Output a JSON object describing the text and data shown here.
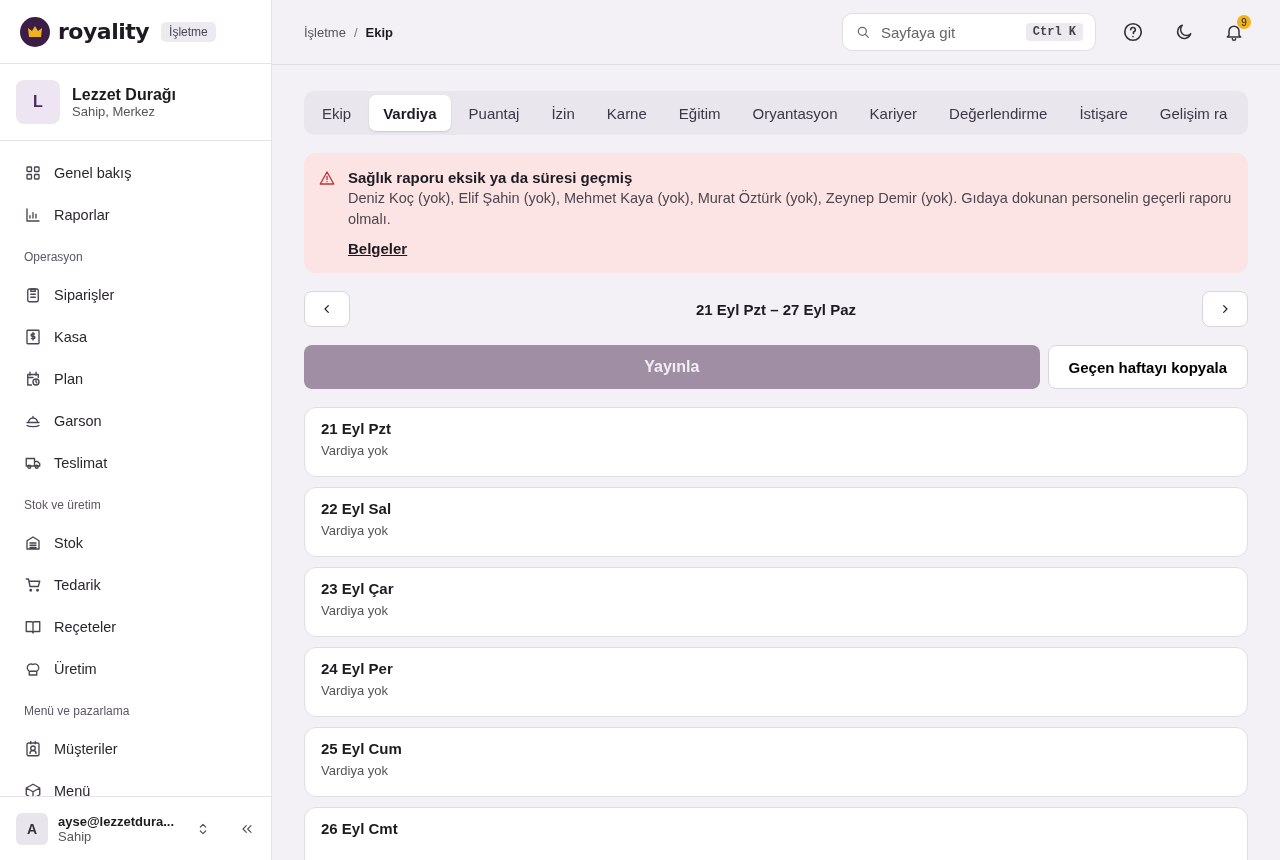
{
  "brand": {
    "name": "royality",
    "badge": "İşletme"
  },
  "org": {
    "initial": "L",
    "name": "Lezzet Durağı",
    "role": "Sahip, Merkez"
  },
  "sidebar": {
    "sections": [
      {
        "items": [
          "Genel bakış",
          "Raporlar"
        ]
      },
      {
        "heading": "Operasyon",
        "items": [
          "Siparişler",
          "Kasa",
          "Plan",
          "Garson",
          "Teslimat"
        ]
      },
      {
        "heading": "Stok ve üretim",
        "items": [
          "Stok",
          "Tedarik",
          "Reçeteler",
          "Üretim"
        ]
      },
      {
        "heading": "Menü ve pazarlama",
        "items": [
          "Müşteriler",
          "Menü"
        ]
      }
    ]
  },
  "user": {
    "initial": "A",
    "email": "ayse@lezzetdura...",
    "role": "Sahip"
  },
  "breadcrumb": [
    "İşletme",
    "Ekip"
  ],
  "breadcrumb_separator": "/",
  "search": {
    "placeholder": "Sayfaya git",
    "shortcut": "Ctrl K"
  },
  "notifications": {
    "count": "9"
  },
  "tabs": [
    {
      "label": "Ekip",
      "selected": false
    },
    {
      "label": "Vardiya",
      "selected": true
    },
    {
      "label": "Puantaj",
      "selected": false
    },
    {
      "label": "İzin",
      "selected": false
    },
    {
      "label": "Karne",
      "selected": false
    },
    {
      "label": "Eğitim",
      "selected": false
    },
    {
      "label": "Oryantasyon",
      "selected": false
    },
    {
      "label": "Kariyer",
      "selected": false
    },
    {
      "label": "Değerlendirme",
      "selected": false
    },
    {
      "label": "İstişare",
      "selected": false
    },
    {
      "label": "Gelişim ra",
      "selected": false
    }
  ],
  "alert": {
    "title": "Sağlık raporu eksik ya da süresi geçmiş",
    "message": "Deniz Koç (yok), Elif Şahin (yok), Mehmet Kaya (yok), Murat Öztürk (yok), Zeynep Demir (yok). Gıdaya dokunan personelin geçerli raporu olmalı.",
    "link": "Belgeler"
  },
  "week": {
    "range": "21 Eyl Pzt – 27 Eyl Paz"
  },
  "actions": {
    "publish": {
      "label": "Yayınla",
      "disabled": true
    },
    "copy": "Geçen haftayı kopyala"
  },
  "days": [
    {
      "date": "21 Eyl Pzt",
      "note": "Vardiya yok"
    },
    {
      "date": "22 Eyl Sal",
      "note": "Vardiya yok"
    },
    {
      "date": "23 Eyl Çar",
      "note": "Vardiya yok"
    },
    {
      "date": "24 Eyl Per",
      "note": "Vardiya yok"
    },
    {
      "date": "25 Eyl Cum",
      "note": "Vardiya yok"
    },
    {
      "date": "26 Eyl Cmt"
    }
  ]
}
